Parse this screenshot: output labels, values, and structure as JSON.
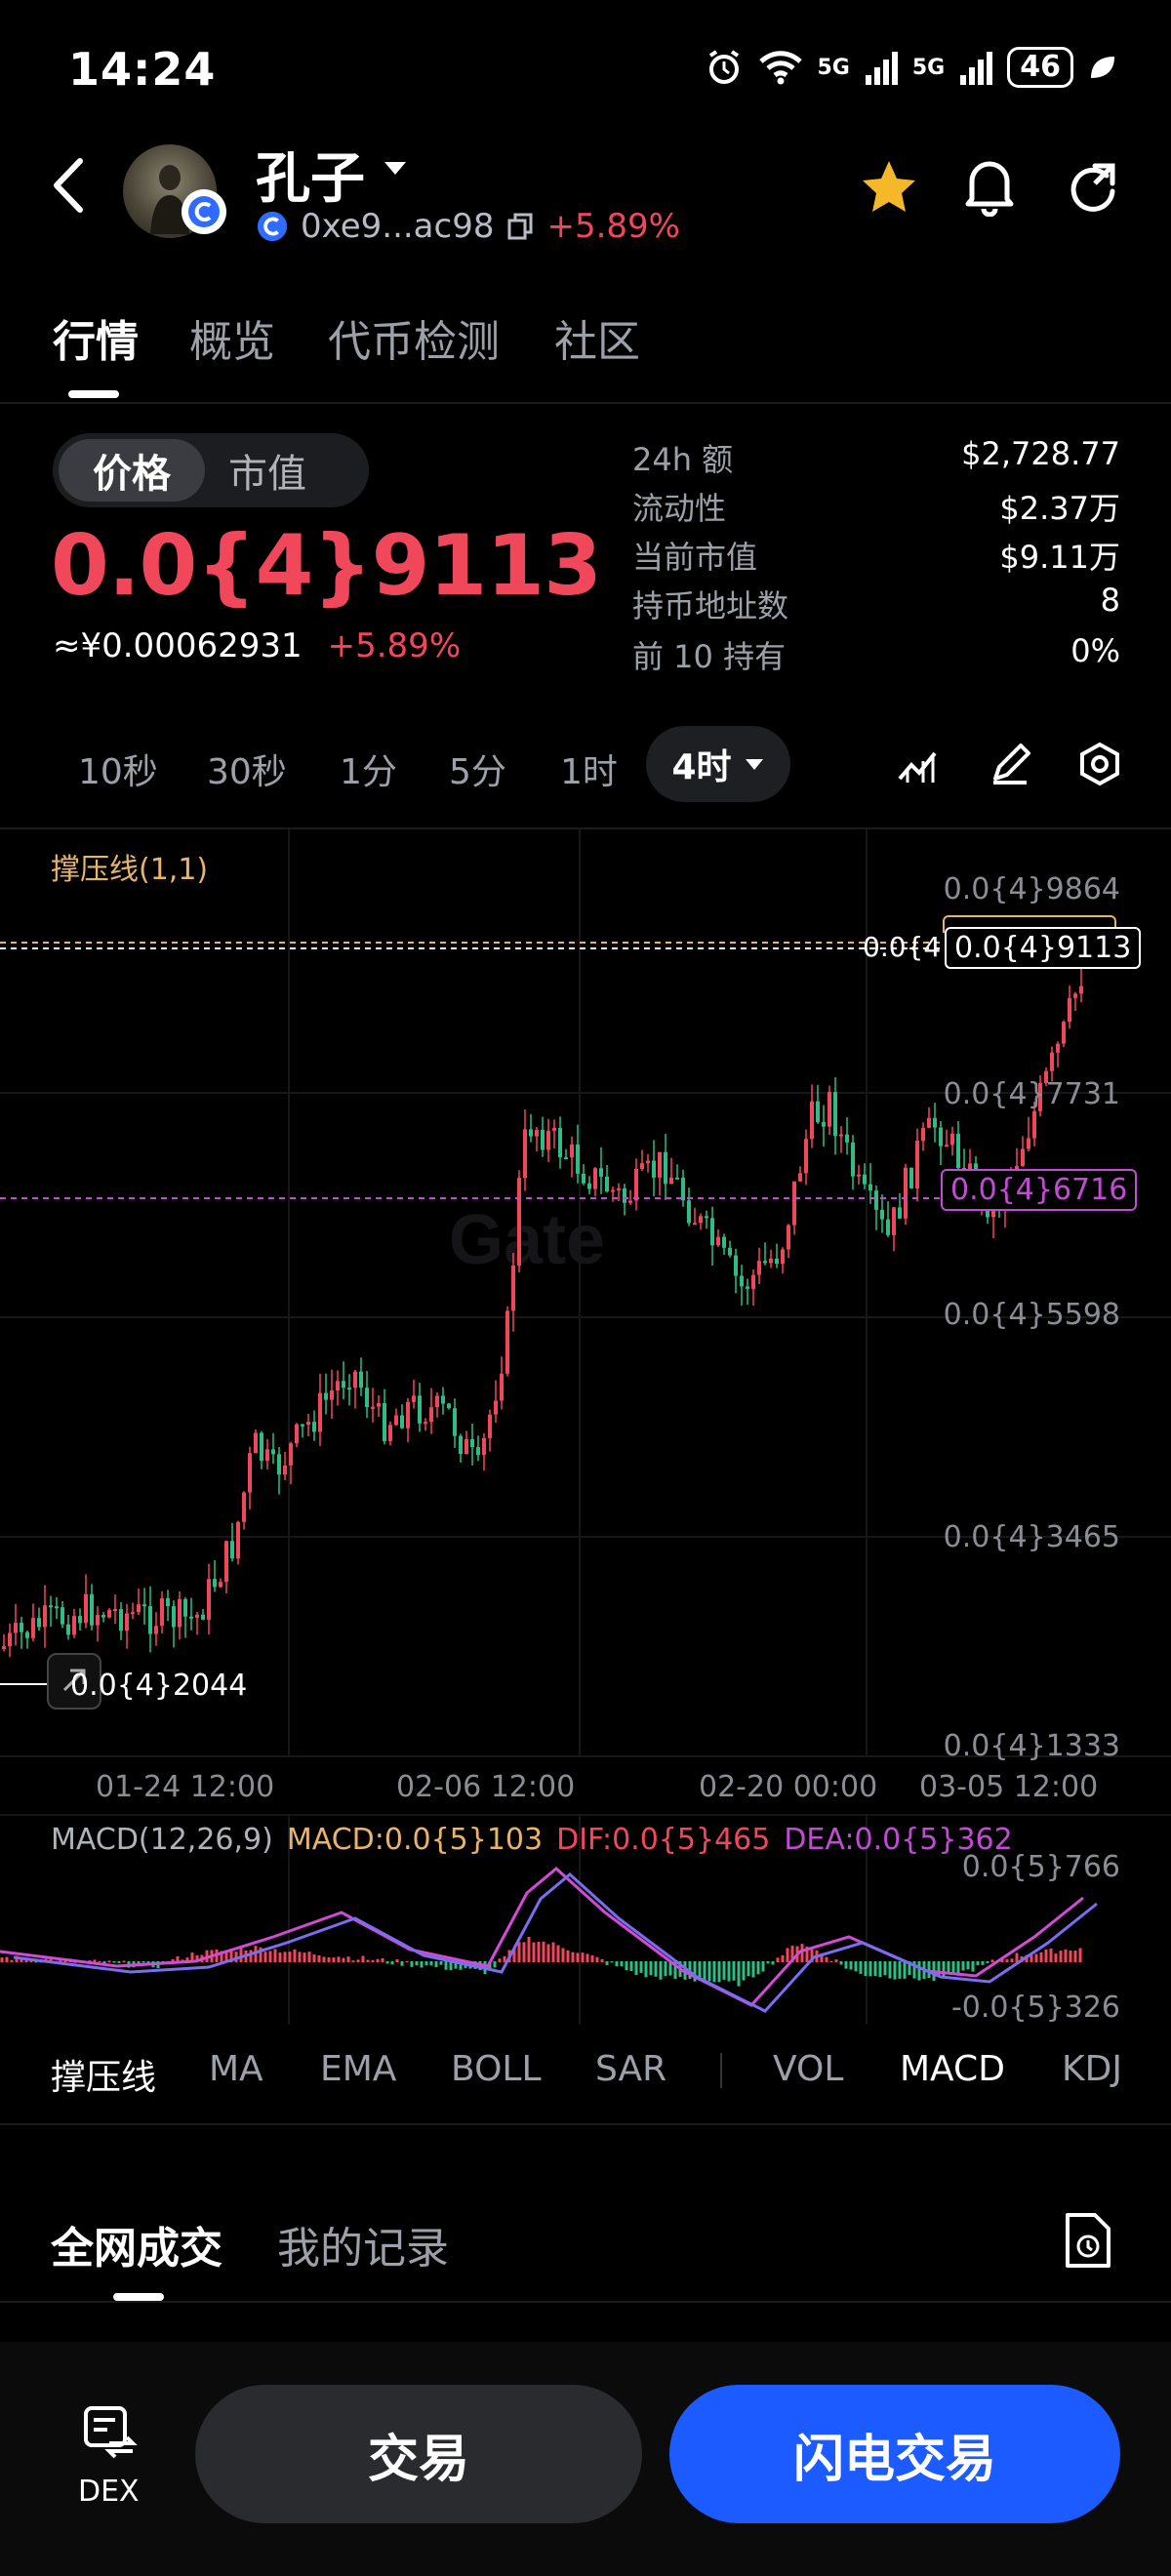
{
  "status_bar": {
    "time": "14:24",
    "net1": "5G",
    "net2": "5G",
    "battery": "46"
  },
  "header": {
    "token_name": "孔子",
    "address": "0xe9...ac98",
    "change": "+5.89%",
    "icons": [
      "back-icon",
      "star-icon",
      "bell-icon",
      "share-icon",
      "copy-icon"
    ]
  },
  "tabs": [
    "行情",
    "概览",
    "代币检测",
    "社区"
  ],
  "price": {
    "toggle": [
      "价格",
      "市值"
    ],
    "value": "0.0{4}9113",
    "cny": "≈¥0.00062931",
    "change": "+5.89%"
  },
  "stats": [
    {
      "label": "24h   额",
      "value": "$2,728.77"
    },
    {
      "label": "流动性",
      "value": "$2.37万"
    },
    {
      "label": "当前市值",
      "value": "$9.11万"
    },
    {
      "label": "持币地址数",
      "value": "8"
    },
    {
      "label": "前 10 持有",
      "value": "0%"
    }
  ],
  "timeframes": [
    "10秒",
    "30秒",
    "1分",
    "5分",
    "1时",
    "4时"
  ],
  "chart": {
    "indicator": "撑压线(1,1)",
    "price_axis": [
      "0.0{4}9864",
      "0.0{4}7731",
      "0.0{4}5598",
      "0.0{4}3465",
      "0.0{4}1333"
    ],
    "current_tag": "0.0{4}9113",
    "current_tag_left": "0.0{4",
    "support_tag": "0.0{4}6716",
    "low_label": "0.0{4}2044",
    "dates": [
      "01-24 12:00",
      "02-06 12:00",
      "02-20 00:00",
      "03-05 12:00"
    ],
    "watermark": "Gate",
    "macd": {
      "name": "MACD(12,26,9)",
      "macd": "MACD:0.0{5}103",
      "dif": "DIF:0.0{5}465",
      "dea": "DEA:0.0{5}362",
      "top": "0.0{5}766",
      "bottom": "-0.0{5}326"
    },
    "colors": {
      "up": "#f0475b",
      "down": "#2ebd85",
      "dif": "#d14bd6",
      "dea": "#7b6cf0"
    }
  },
  "indicator_tabs": [
    "撑压线",
    "MA",
    "EMA",
    "BOLL",
    "SAR",
    "VOL",
    "MACD",
    "KDJ"
  ],
  "trade_tabs": [
    "全网成交",
    "我的记录"
  ],
  "bottom": {
    "dex": "DEX",
    "trade": "交易",
    "flash": "闪电交易"
  }
}
